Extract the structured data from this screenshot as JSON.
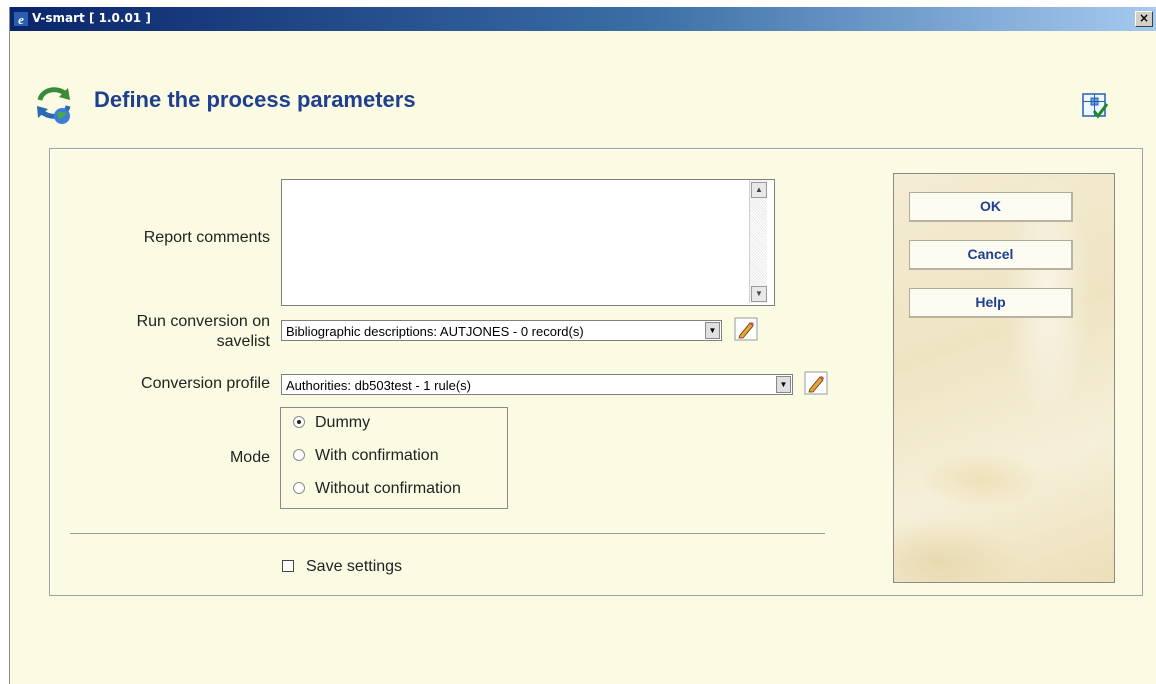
{
  "window": {
    "title": "V-smart [ 1.0.01 ]",
    "close_symbol": "×",
    "icon": "ie-icon"
  },
  "page": {
    "title": "Define the process parameters",
    "icon": "conversion-process-icon",
    "wizard_icon": "wizard-checklist-icon"
  },
  "form": {
    "report_comments": {
      "label": "Report comments",
      "value": ""
    },
    "savelist": {
      "label_line1": "Run conversion on",
      "label_line2": "savelist",
      "value": "Bibliographic descriptions: AUTJONES - 0 record(s)"
    },
    "profile": {
      "label": "Conversion profile",
      "value": "Authorities: db503test - 1 rule(s)"
    },
    "mode": {
      "label": "Mode",
      "options": [
        "Dummy",
        "With confirmation",
        "Without confirmation"
      ],
      "selected": "Dummy"
    },
    "save_settings": {
      "label": "Save settings",
      "checked": false
    }
  },
  "buttons": {
    "ok": "OK",
    "cancel": "Cancel",
    "help": "Help"
  },
  "colors": {
    "background": "#fbfbe3",
    "title_text": "#1f3f8f",
    "titlebar": "#0a246a"
  }
}
